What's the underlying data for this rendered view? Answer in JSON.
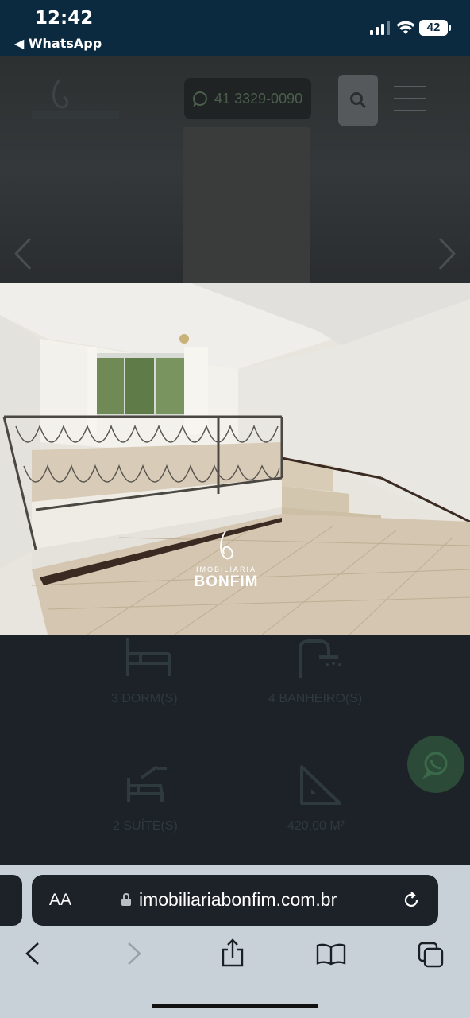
{
  "status_bar": {
    "time": "12:42",
    "back_app": "◀ WhatsApp",
    "battery": "42"
  },
  "header": {
    "phone": "41 3329-0090"
  },
  "watermark": {
    "sub": "IMOBILIARIA",
    "main": "BONFIM"
  },
  "features": [
    {
      "label": "3 DORM(S)",
      "icon": "bed-icon"
    },
    {
      "label": "4 BANHEIRO(S)",
      "icon": "shower-icon"
    },
    {
      "label": "2 SUÍTE(S)",
      "icon": "suite-bath-icon"
    },
    {
      "label": "420,00 M²",
      "icon": "area-triangle-icon"
    }
  ],
  "safari": {
    "aa": "AA",
    "url": "imobiliariabonfim.com.br"
  },
  "colors": {
    "status_bar": "#0b2a40",
    "overlay_bg": "#1d2228",
    "safari_bg": "#c9d1d8",
    "whatsapp_green": "#2c4a38"
  }
}
